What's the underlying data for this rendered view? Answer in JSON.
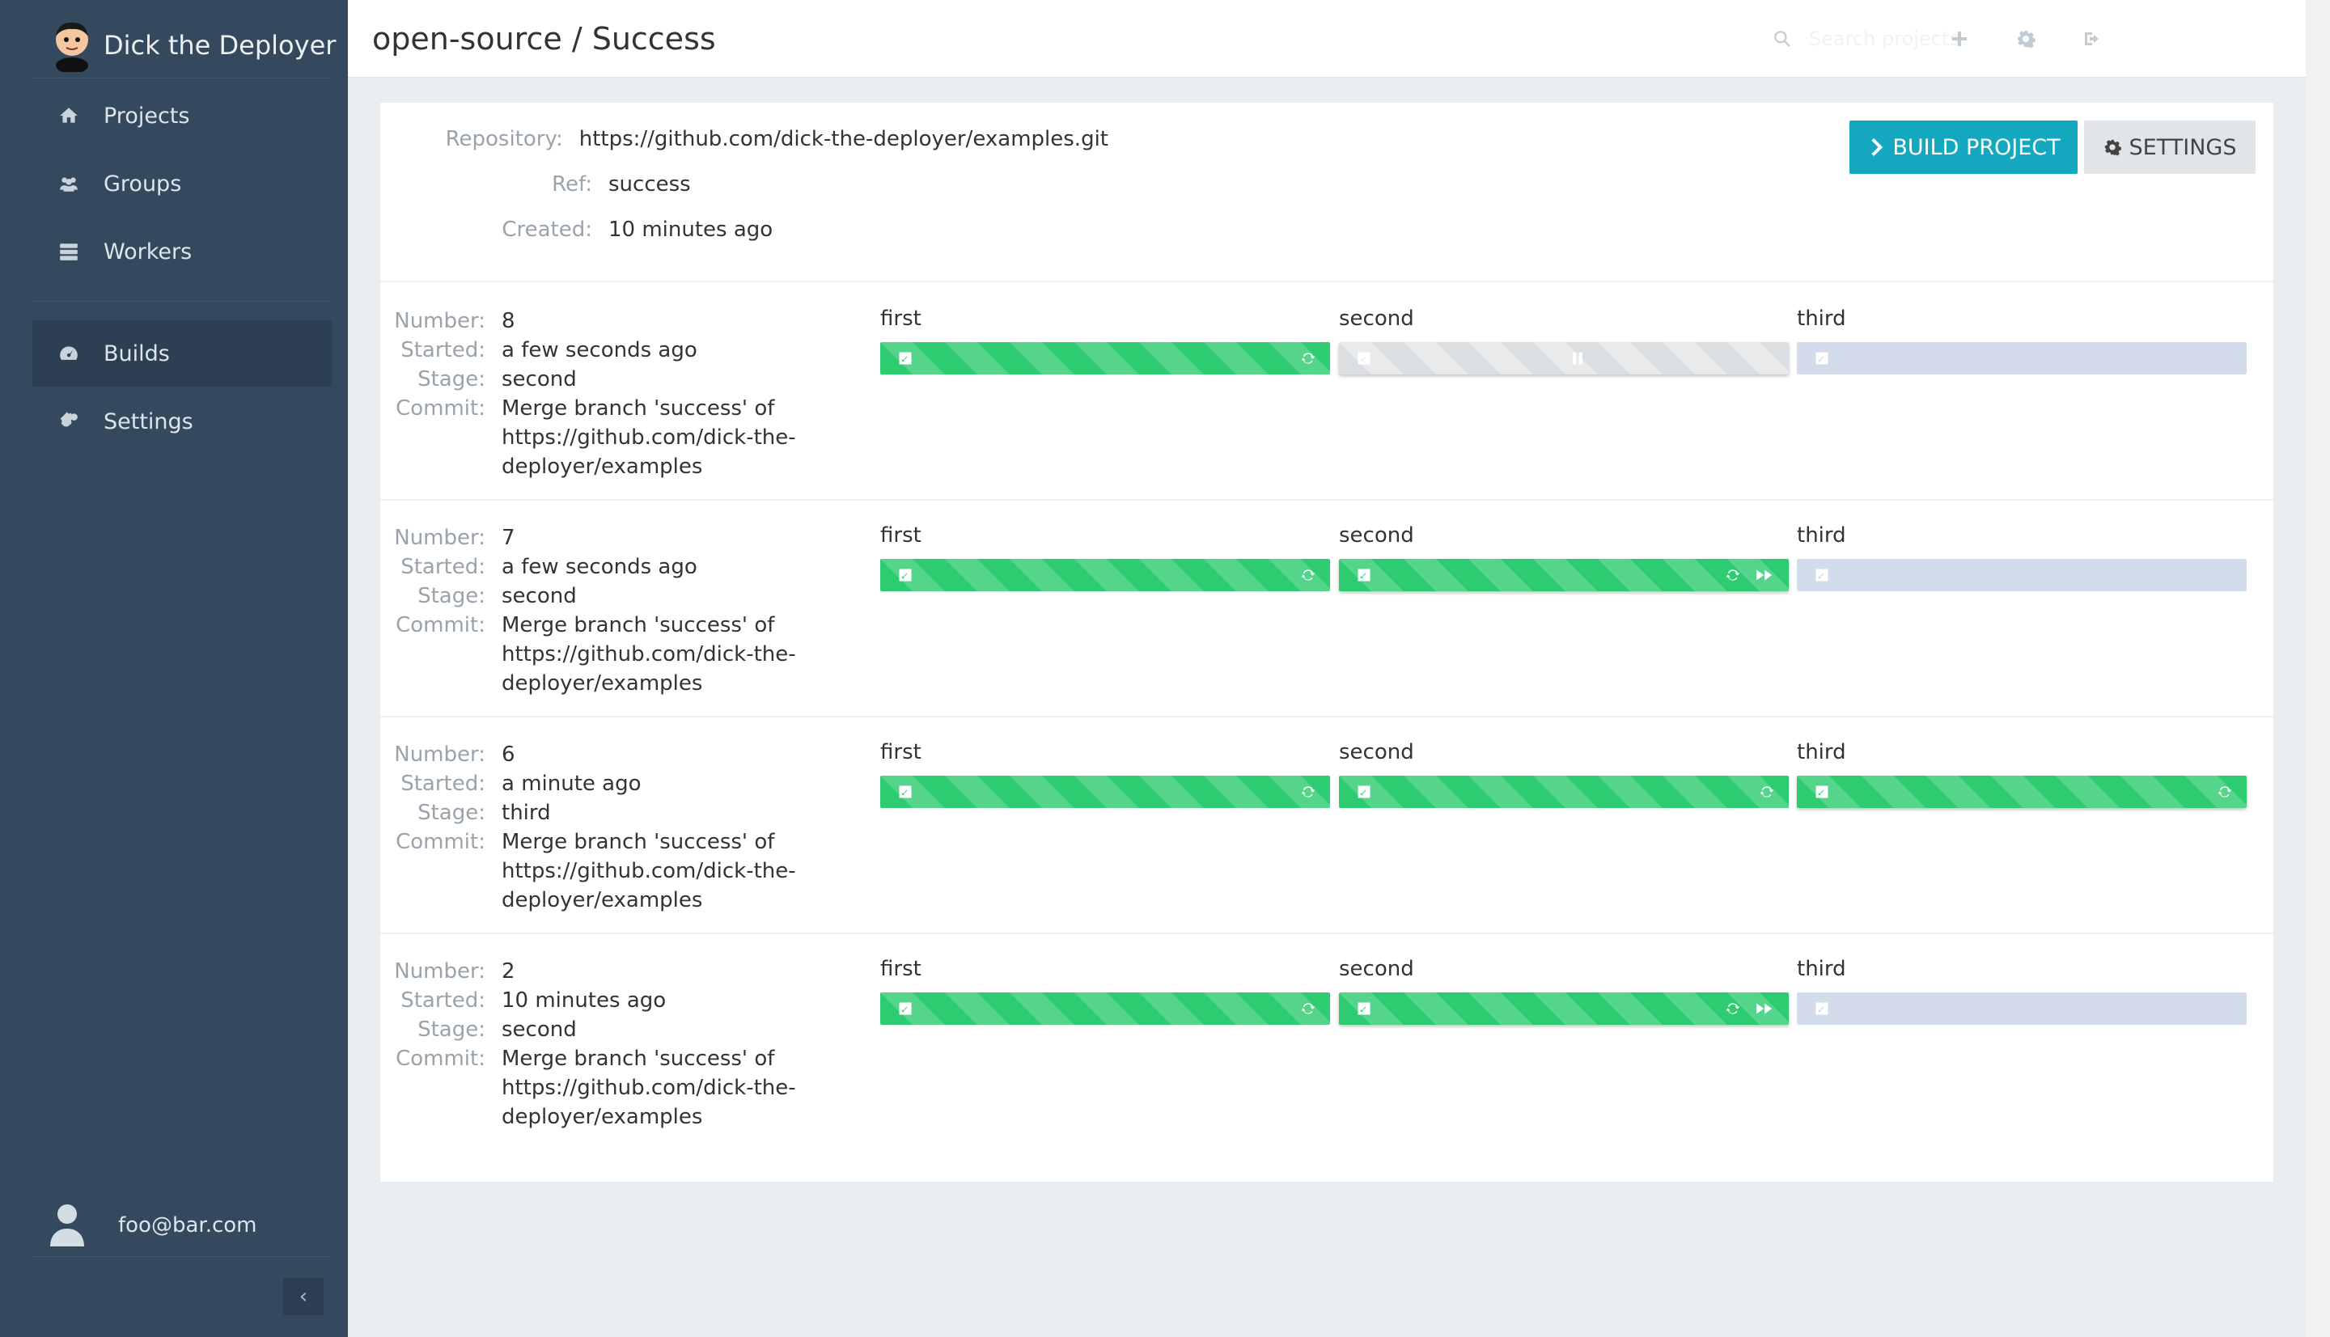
{
  "sidebar": {
    "brand": "Dick the Deployer",
    "nav": [
      {
        "label": "Projects",
        "icon": "home-icon"
      },
      {
        "label": "Groups",
        "icon": "users-icon"
      },
      {
        "label": "Workers",
        "icon": "server-icon"
      },
      {
        "label": "Builds",
        "icon": "dashboard-icon",
        "active": true
      },
      {
        "label": "Settings",
        "icon": "cogs-icon"
      }
    ],
    "user": "foo@bar.com",
    "collapse": "‹"
  },
  "topbar": {
    "title": "open-source / Success",
    "search_placeholder": "Search projects"
  },
  "project": {
    "repository_label": "Repository:",
    "repository": "https://github.com/dick-the-deployer/examples.git",
    "ref_label": "Ref:",
    "ref": "success",
    "created_label": "Created:",
    "created": "10 minutes ago"
  },
  "actions": {
    "build": "BUILD PROJECT",
    "settings": "SETTINGS"
  },
  "labels": {
    "number": "Number:",
    "started": "Started:",
    "stage": "Stage:",
    "commit": "Commit:"
  },
  "colors": {
    "sidebar": "#34495e",
    "accent": "#13a8c0",
    "success": "#2ecc71",
    "pending": "#d3dcea",
    "running": "#dcdfe2"
  },
  "builds": [
    {
      "number": "8",
      "started": "a few seconds ago",
      "stage": "second",
      "commit": "Merge branch 'success' of https://github.com/dick-the-deployer/examples",
      "stages": [
        {
          "name": "first",
          "status": "success"
        },
        {
          "name": "second",
          "status": "running"
        },
        {
          "name": "third",
          "status": "pending"
        }
      ]
    },
    {
      "number": "7",
      "started": "a few seconds ago",
      "stage": "second",
      "commit": "Merge branch 'success' of https://github.com/dick-the-deployer/examples",
      "stages": [
        {
          "name": "first",
          "status": "success"
        },
        {
          "name": "second",
          "status": "success-current"
        },
        {
          "name": "third",
          "status": "pending"
        }
      ]
    },
    {
      "number": "6",
      "started": "a minute ago",
      "stage": "third",
      "commit": "Merge branch 'success' of https://github.com/dick-the-deployer/examples",
      "stages": [
        {
          "name": "first",
          "status": "success"
        },
        {
          "name": "second",
          "status": "success"
        },
        {
          "name": "third",
          "status": "success-last"
        }
      ]
    },
    {
      "number": "2",
      "started": "10 minutes ago",
      "stage": "second",
      "commit": "Merge branch 'success' of https://github.com/dick-the-deployer/examples",
      "stages": [
        {
          "name": "first",
          "status": "success"
        },
        {
          "name": "second",
          "status": "success-current"
        },
        {
          "name": "third",
          "status": "pending"
        }
      ]
    }
  ]
}
